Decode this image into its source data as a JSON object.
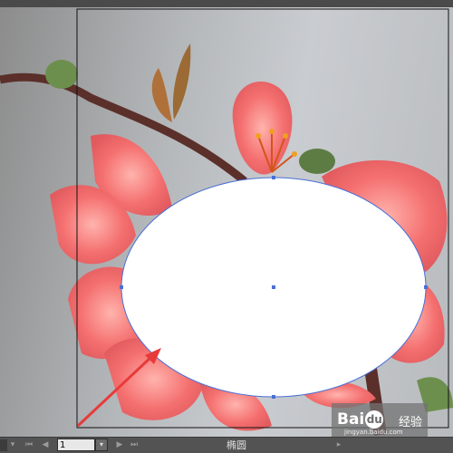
{
  "statusbar": {
    "page_value": "1",
    "tool_name": "椭圆",
    "first_icon": "first-page-icon",
    "prev_icon": "prev-page-icon",
    "next_icon": "next-page-icon",
    "last_icon": "last-page-icon"
  },
  "watermark": {
    "logo_prefix": "Bai",
    "logo_glyph": "du",
    "tag": "经验",
    "url": "jingyan.baidu.com"
  },
  "colors": {
    "petal": "#f37a7a",
    "selection": "#4a6fd6",
    "arrow": "#e83a3a",
    "statusbar": "#535353"
  }
}
